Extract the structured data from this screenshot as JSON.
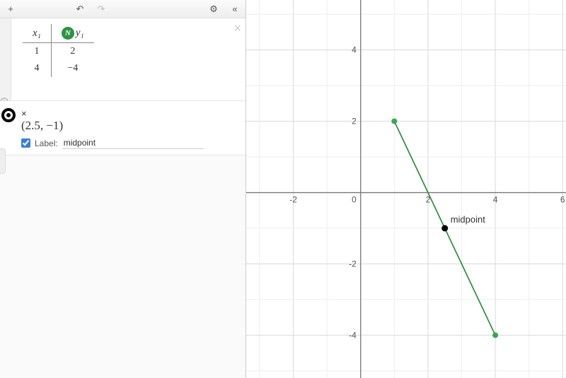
{
  "toolbar": {
    "add": "+",
    "undo": "↶",
    "redo": "↷",
    "settings": "⚙",
    "collapse": "«"
  },
  "table": {
    "headers": {
      "x": "x₁",
      "y": "y₁"
    },
    "rows": [
      {
        "x": "1",
        "y": "2"
      },
      {
        "x": "4",
        "y": "−4"
      }
    ]
  },
  "point_expr": {
    "formula": "(2.5, −1)",
    "label_caption": "Label:",
    "label_value": "midpoint"
  },
  "chart_data": {
    "type": "scatter",
    "xlim": [
      -3.4,
      6.1
    ],
    "ylim": [
      -5.2,
      5.4
    ],
    "x_ticks": [
      -2,
      0,
      2,
      4,
      6
    ],
    "y_ticks": [
      -4,
      -2,
      2,
      4
    ],
    "points": [
      {
        "x": 1,
        "y": 2
      },
      {
        "x": 4,
        "y": -4
      }
    ],
    "segment": {
      "from": [
        1,
        2
      ],
      "to": [
        4,
        -4
      ]
    },
    "midpoint": {
      "x": 2.5,
      "y": -1,
      "label": "midpoint"
    }
  }
}
